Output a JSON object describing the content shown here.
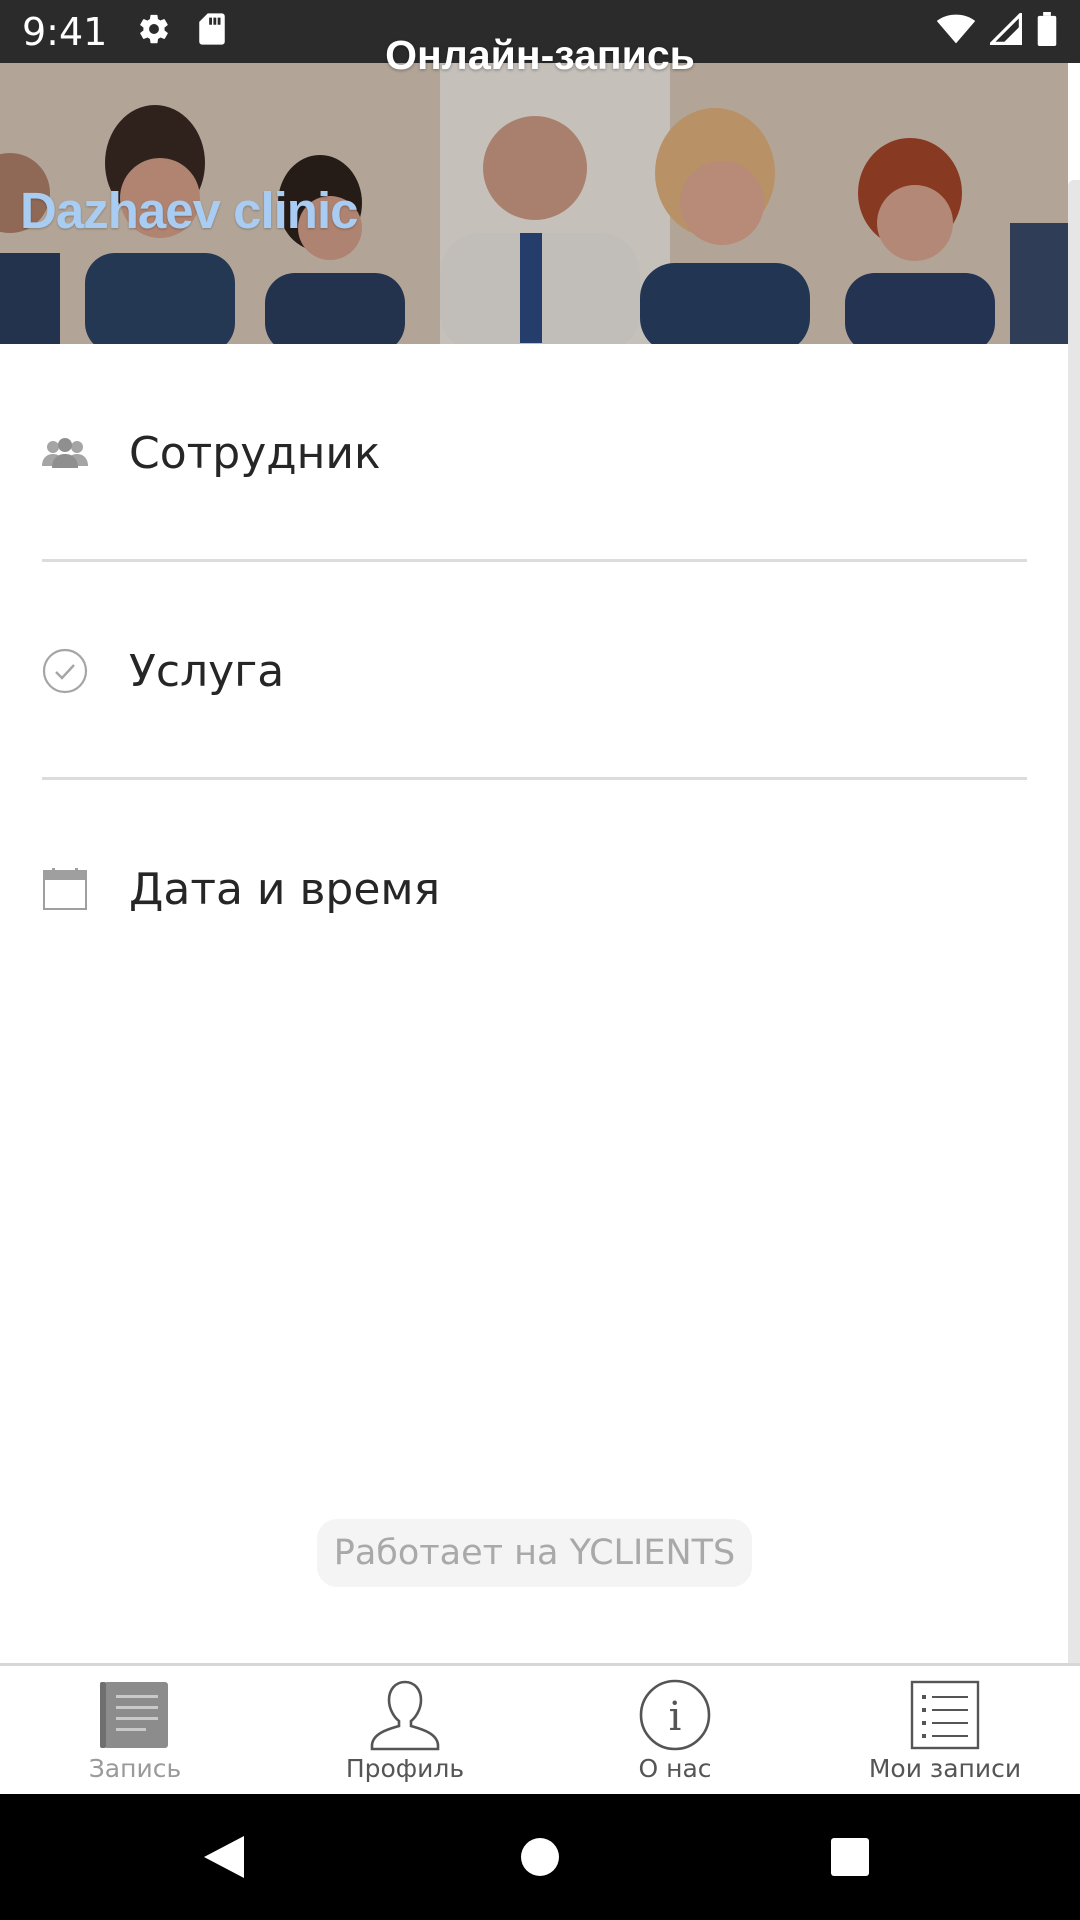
{
  "status_bar": {
    "time": "9:41",
    "left_icons": [
      "settings-icon",
      "sd-card-icon"
    ],
    "right_icons": [
      "wifi-icon",
      "cellular-signal-icon",
      "battery-icon"
    ]
  },
  "header": {
    "title": "Онлайн-запись",
    "clinic_name": "Dazhaev clinic",
    "clinic_name_color": "#a9cdf2"
  },
  "booking_steps": [
    {
      "label": "Сотрудник",
      "icon": "staff-group-icon"
    },
    {
      "label": "Услуга",
      "icon": "check-circle-icon"
    },
    {
      "label": "Дата и время",
      "icon": "calendar-icon"
    }
  ],
  "powered_by": "Работает на YCLIENTS",
  "tab_bar": {
    "tabs": [
      {
        "label": "Запись",
        "icon": "booking-list-icon",
        "active": true
      },
      {
        "label": "Профиль",
        "icon": "profile-icon",
        "active": false
      },
      {
        "label": "О нас",
        "icon": "info-icon",
        "active": false
      },
      {
        "label": "Мои записи",
        "icon": "my-records-icon",
        "active": false
      }
    ]
  },
  "nav_bar": {
    "buttons": [
      "back-icon",
      "home-icon",
      "recents-icon"
    ]
  }
}
